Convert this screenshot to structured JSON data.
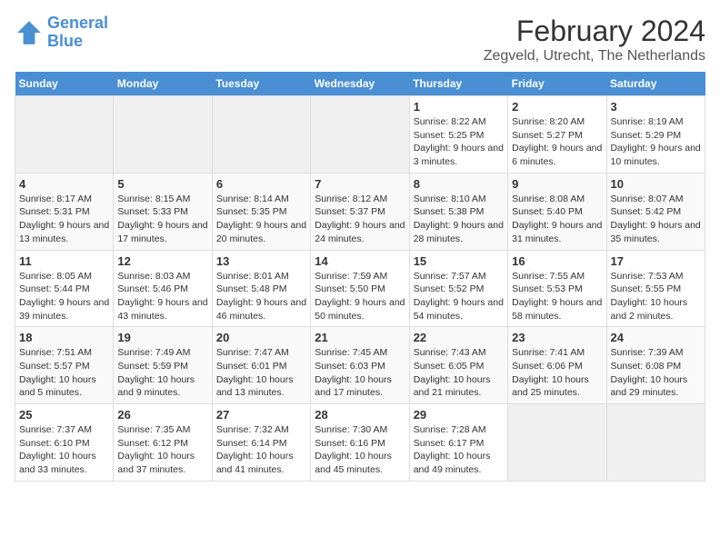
{
  "logo": {
    "line1": "General",
    "line2": "Blue"
  },
  "title": "February 2024",
  "subtitle": "Zegveld, Utrecht, The Netherlands",
  "weekdays": [
    "Sunday",
    "Monday",
    "Tuesday",
    "Wednesday",
    "Thursday",
    "Friday",
    "Saturday"
  ],
  "weeks": [
    [
      {
        "day": "",
        "empty": true
      },
      {
        "day": "",
        "empty": true
      },
      {
        "day": "",
        "empty": true
      },
      {
        "day": "",
        "empty": true
      },
      {
        "day": "1",
        "sunrise": "8:22 AM",
        "sunset": "5:25 PM",
        "daylight": "9 hours and 3 minutes."
      },
      {
        "day": "2",
        "sunrise": "8:20 AM",
        "sunset": "5:27 PM",
        "daylight": "9 hours and 6 minutes."
      },
      {
        "day": "3",
        "sunrise": "8:19 AM",
        "sunset": "5:29 PM",
        "daylight": "9 hours and 10 minutes."
      }
    ],
    [
      {
        "day": "4",
        "sunrise": "8:17 AM",
        "sunset": "5:31 PM",
        "daylight": "9 hours and 13 minutes."
      },
      {
        "day": "5",
        "sunrise": "8:15 AM",
        "sunset": "5:33 PM",
        "daylight": "9 hours and 17 minutes."
      },
      {
        "day": "6",
        "sunrise": "8:14 AM",
        "sunset": "5:35 PM",
        "daylight": "9 hours and 20 minutes."
      },
      {
        "day": "7",
        "sunrise": "8:12 AM",
        "sunset": "5:37 PM",
        "daylight": "9 hours and 24 minutes."
      },
      {
        "day": "8",
        "sunrise": "8:10 AM",
        "sunset": "5:38 PM",
        "daylight": "9 hours and 28 minutes."
      },
      {
        "day": "9",
        "sunrise": "8:08 AM",
        "sunset": "5:40 PM",
        "daylight": "9 hours and 31 minutes."
      },
      {
        "day": "10",
        "sunrise": "8:07 AM",
        "sunset": "5:42 PM",
        "daylight": "9 hours and 35 minutes."
      }
    ],
    [
      {
        "day": "11",
        "sunrise": "8:05 AM",
        "sunset": "5:44 PM",
        "daylight": "9 hours and 39 minutes."
      },
      {
        "day": "12",
        "sunrise": "8:03 AM",
        "sunset": "5:46 PM",
        "daylight": "9 hours and 43 minutes."
      },
      {
        "day": "13",
        "sunrise": "8:01 AM",
        "sunset": "5:48 PM",
        "daylight": "9 hours and 46 minutes."
      },
      {
        "day": "14",
        "sunrise": "7:59 AM",
        "sunset": "5:50 PM",
        "daylight": "9 hours and 50 minutes."
      },
      {
        "day": "15",
        "sunrise": "7:57 AM",
        "sunset": "5:52 PM",
        "daylight": "9 hours and 54 minutes."
      },
      {
        "day": "16",
        "sunrise": "7:55 AM",
        "sunset": "5:53 PM",
        "daylight": "9 hours and 58 minutes."
      },
      {
        "day": "17",
        "sunrise": "7:53 AM",
        "sunset": "5:55 PM",
        "daylight": "10 hours and 2 minutes."
      }
    ],
    [
      {
        "day": "18",
        "sunrise": "7:51 AM",
        "sunset": "5:57 PM",
        "daylight": "10 hours and 5 minutes."
      },
      {
        "day": "19",
        "sunrise": "7:49 AM",
        "sunset": "5:59 PM",
        "daylight": "10 hours and 9 minutes."
      },
      {
        "day": "20",
        "sunrise": "7:47 AM",
        "sunset": "6:01 PM",
        "daylight": "10 hours and 13 minutes."
      },
      {
        "day": "21",
        "sunrise": "7:45 AM",
        "sunset": "6:03 PM",
        "daylight": "10 hours and 17 minutes."
      },
      {
        "day": "22",
        "sunrise": "7:43 AM",
        "sunset": "6:05 PM",
        "daylight": "10 hours and 21 minutes."
      },
      {
        "day": "23",
        "sunrise": "7:41 AM",
        "sunset": "6:06 PM",
        "daylight": "10 hours and 25 minutes."
      },
      {
        "day": "24",
        "sunrise": "7:39 AM",
        "sunset": "6:08 PM",
        "daylight": "10 hours and 29 minutes."
      }
    ],
    [
      {
        "day": "25",
        "sunrise": "7:37 AM",
        "sunset": "6:10 PM",
        "daylight": "10 hours and 33 minutes."
      },
      {
        "day": "26",
        "sunrise": "7:35 AM",
        "sunset": "6:12 PM",
        "daylight": "10 hours and 37 minutes."
      },
      {
        "day": "27",
        "sunrise": "7:32 AM",
        "sunset": "6:14 PM",
        "daylight": "10 hours and 41 minutes."
      },
      {
        "day": "28",
        "sunrise": "7:30 AM",
        "sunset": "6:16 PM",
        "daylight": "10 hours and 45 minutes."
      },
      {
        "day": "29",
        "sunrise": "7:28 AM",
        "sunset": "6:17 PM",
        "daylight": "10 hours and 49 minutes."
      },
      {
        "day": "",
        "empty": true
      },
      {
        "day": "",
        "empty": true
      }
    ]
  ]
}
